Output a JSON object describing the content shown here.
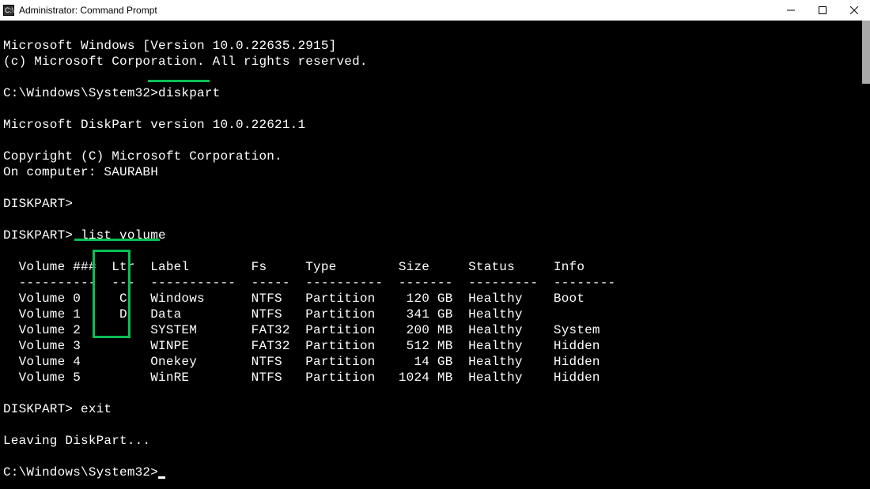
{
  "window": {
    "title": "Administrator: Command Prompt"
  },
  "lines": {
    "version": "Microsoft Windows [Version 10.0.22635.2915]",
    "copyright": "(c) Microsoft Corporation. All rights reserved.",
    "prompt1": "C:\\Windows\\System32>",
    "command1": "diskpart",
    "diskpart_version": "Microsoft DiskPart version 10.0.22621.1",
    "diskpart_copyright": "Copyright (C) Microsoft Corporation.",
    "computer": "On computer: SAURABH",
    "dp_prompt1": "DISKPART>",
    "dp_prompt2": "DISKPART> ",
    "command2": "list volume",
    "header": "  Volume ###  Ltr  Label        Fs     Type        Size     Status     Info",
    "divider": "  ----------  ---  -----------  -----  ----------  -------  ---------  --------",
    "row0": "  Volume 0     C   Windows      NTFS   Partition    120 GB  Healthy    Boot",
    "row1": "  Volume 1     D   Data         NTFS   Partition    341 GB  Healthy",
    "row2": "  Volume 2         SYSTEM       FAT32  Partition    200 MB  Healthy    System",
    "row3": "  Volume 3         WINPE        FAT32  Partition    512 MB  Healthy    Hidden",
    "row4": "  Volume 4         Onekey       NTFS   Partition     14 GB  Healthy    Hidden",
    "row5": "  Volume 5         WinRE        NTFS   Partition   1024 MB  Healthy    Hidden",
    "dp_prompt3": "DISKPART> exit",
    "leaving": "Leaving DiskPart...",
    "prompt2": "C:\\Windows\\System32>"
  }
}
